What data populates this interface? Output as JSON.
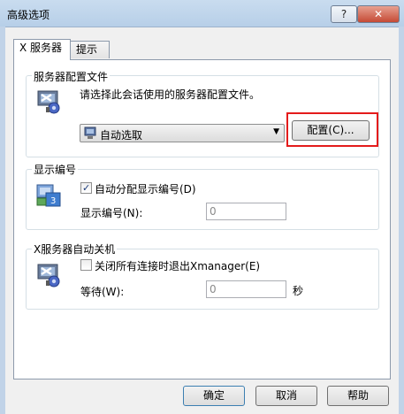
{
  "window": {
    "title": "高级选项",
    "help_label": "?",
    "close_label": "✕"
  },
  "tabs": [
    {
      "label": "X 服务器",
      "active": true
    },
    {
      "label": "提示",
      "active": false
    }
  ],
  "profile_group": {
    "label": "服务器配置文件",
    "description": "请选择此会话使用的服务器配置文件。",
    "combo_value": "自动选取",
    "config_button": "配置(C)..."
  },
  "display_group": {
    "label": "显示编号",
    "auto_assign_label": "自动分配显示编号(D)",
    "auto_assign_checked": true,
    "number_label": "显示编号(N):",
    "number_value": "0"
  },
  "shutdown_group": {
    "label": "X服务器自动关机",
    "exit_label": "关闭所有连接时退出Xmanager(E)",
    "exit_checked": false,
    "wait_label": "等待(W):",
    "wait_value": "0",
    "unit": "秒"
  },
  "footer": {
    "ok_label": "确定",
    "cancel_label": "取消",
    "help_label": "帮助"
  },
  "colors": {
    "highlight": "#e41b1b",
    "titlebar": "#c9dcef"
  }
}
